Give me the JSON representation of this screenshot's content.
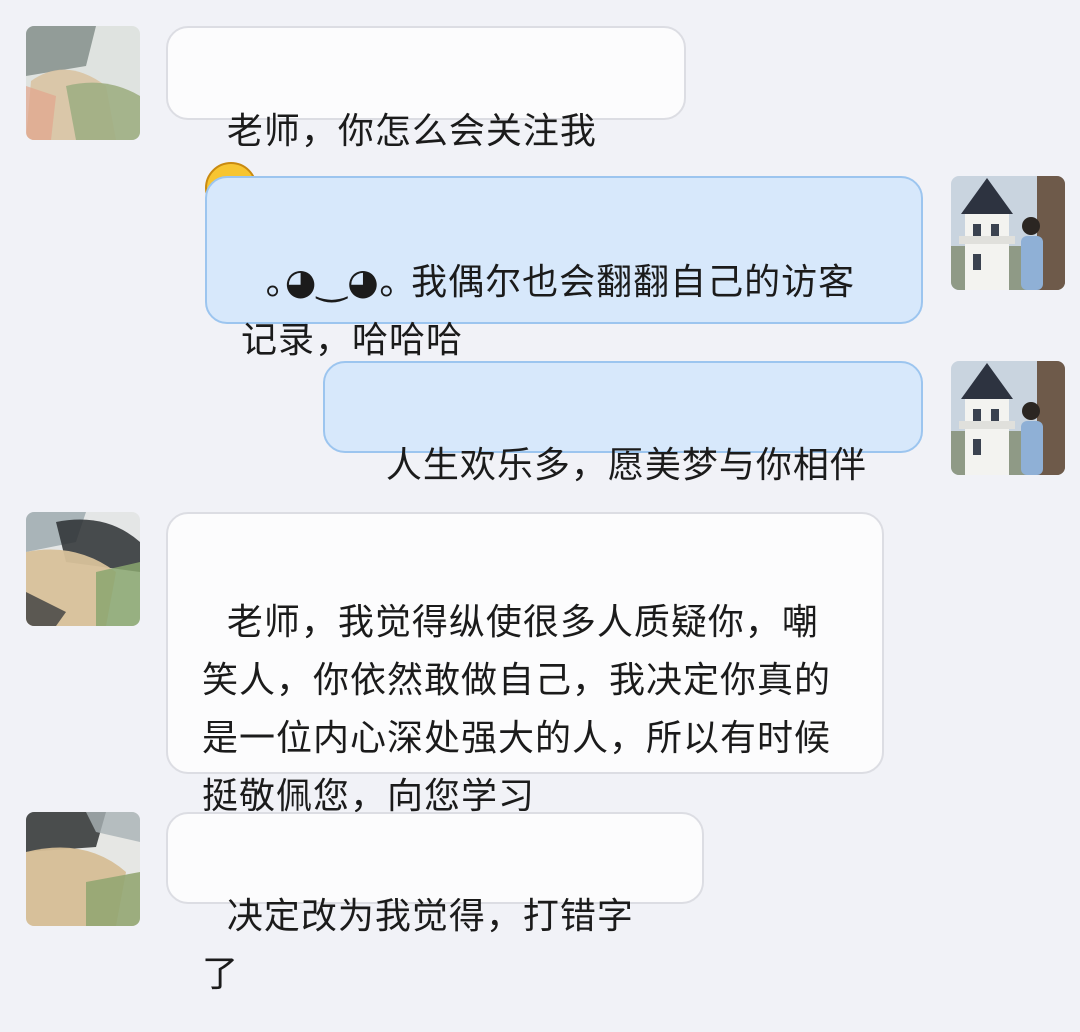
{
  "chat": {
    "messages": [
      {
        "side": "left",
        "text": "老师，你怎么会关注我",
        "emoji": "grinning-face"
      },
      {
        "side": "right",
        "text": "｡◕‿◕｡ 我偶尔也会翻翻自己的访客记录，哈哈哈"
      },
      {
        "side": "right",
        "text": "人生欢乐多，愿美梦与你相伴~"
      },
      {
        "side": "left",
        "text": "老师，我觉得纵使很多人质疑你，嘲笑人，你依然敢做自己，我决定你真的是一位内心深处强大的人，所以有时候挺敬佩您，向您学习"
      },
      {
        "side": "left",
        "text": "决定改为我觉得，打错字了"
      }
    ]
  },
  "colors": {
    "background": "#f1f2f7",
    "left_bubble": "#fcfcfd",
    "right_bubble": "#d7e8fb",
    "right_bubble_border": "#9cc5ef"
  }
}
